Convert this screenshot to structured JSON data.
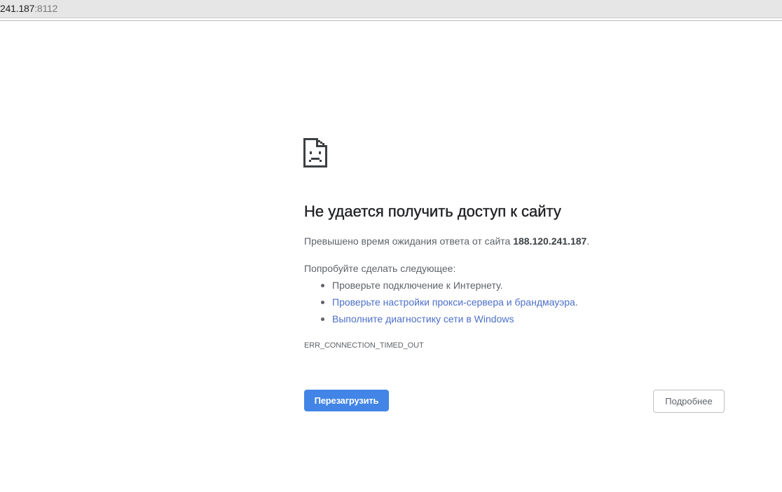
{
  "address_bar": {
    "host": "241.187",
    "port": ":8112"
  },
  "error": {
    "icon": "sad-page-icon",
    "title": "Не удается получить доступ к сайту",
    "summary_prefix": "Превышено время ожидания ответа от сайта ",
    "summary_host": "188.120.241.187",
    "summary_suffix": ".",
    "suggest_heading": "Попробуйте сделать следующее:",
    "suggestions": [
      {
        "text": "Проверьте подключение к Интернету.",
        "link": false,
        "suffix": ""
      },
      {
        "text": "Проверьте настройки прокси-сервера и брандмауэра",
        "link": true,
        "suffix": "."
      },
      {
        "text": "Выполните диагностику сети в Windows",
        "link": true,
        "suffix": ""
      }
    ],
    "code": "ERR_CONNECTION_TIMED_OUT"
  },
  "buttons": {
    "reload_label": "Перезагрузить",
    "details_label": "Подробнее"
  },
  "colors": {
    "primary_button": "#4285e6",
    "link": "#4c6fc7",
    "title": "#202124",
    "body_text": "#5f6368"
  }
}
